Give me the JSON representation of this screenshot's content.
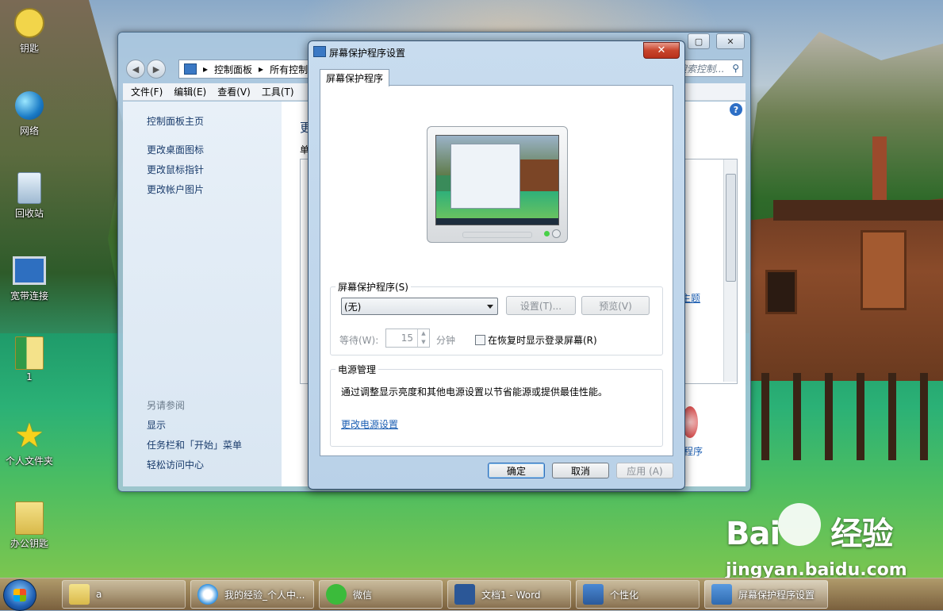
{
  "desktop_icons": [
    {
      "label": "钥匙",
      "icon": "key-icon"
    },
    {
      "label": "网络",
      "icon": "network-icon"
    },
    {
      "label": "回收站",
      "icon": "recycle-bin-icon"
    },
    {
      "label": "宽带连接",
      "icon": "broadband-icon"
    },
    {
      "label": "1",
      "icon": "folder-icon"
    },
    {
      "label": "个人文件夹",
      "icon": "star-folder-icon"
    },
    {
      "label": "办公钥匙",
      "icon": "folder-icon"
    }
  ],
  "control_panel": {
    "breadcrumb": [
      "控制面板",
      "所有控制"
    ],
    "search_placeholder": "搜索控制...",
    "menu": [
      "文件(F)",
      "编辑(E)",
      "查看(V)",
      "工具(T)"
    ],
    "left_links": [
      "控制面板主页",
      "更改桌面图标",
      "更改鼠标指针",
      "更改帐户图片"
    ],
    "see_also_heading": "另请参阅",
    "see_also_links": [
      "显示",
      "任务栏和「开始」菜单",
      "轻松访问中心"
    ],
    "right_partial": [
      "更",
      "单"
    ],
    "right_link_theme": "主题",
    "right_link_screensaver": "护程序"
  },
  "dialog": {
    "title": "屏幕保护程序设置",
    "close_label": "✕",
    "tab_label": "屏幕保护程序",
    "screensaver_group_label": "屏幕保护程序(S)",
    "selected_screensaver": "(无)",
    "settings_button": "设置(T)...",
    "preview_button": "预览(V)",
    "wait_label": "等待(W):",
    "wait_value": "15",
    "minutes_label": "分钟",
    "resume_checkbox_label": "在恢复时显示登录屏幕(R)",
    "resume_checked": false,
    "power_group_label": "电源管理",
    "power_description": "通过调整显示亮度和其他电源设置以节省能源或提供最佳性能。",
    "power_link": "更改电源设置",
    "ok_button": "确定",
    "cancel_button": "取消",
    "apply_button": "应用 (A)"
  },
  "taskbar": {
    "items": [
      {
        "label": "a",
        "icon": "folder-icon"
      },
      {
        "label": "我的经验_个人中...",
        "icon": "browser-icon"
      },
      {
        "label": "微信",
        "icon": "wechat-icon"
      },
      {
        "label": "文档1 - Word",
        "icon": "word-icon"
      },
      {
        "label": "个性化",
        "icon": "personalize-icon"
      },
      {
        "label": "屏幕保护程序设置",
        "icon": "screensaver-icon"
      }
    ],
    "active_index": 5
  },
  "watermark": {
    "brand_left": "Bai",
    "brand_right": "经验",
    "url": "jingyan.baidu.com"
  },
  "colors": {
    "accent": "#1c5fb3",
    "close_red": "#c8442c",
    "link": "#1a3c6c"
  }
}
